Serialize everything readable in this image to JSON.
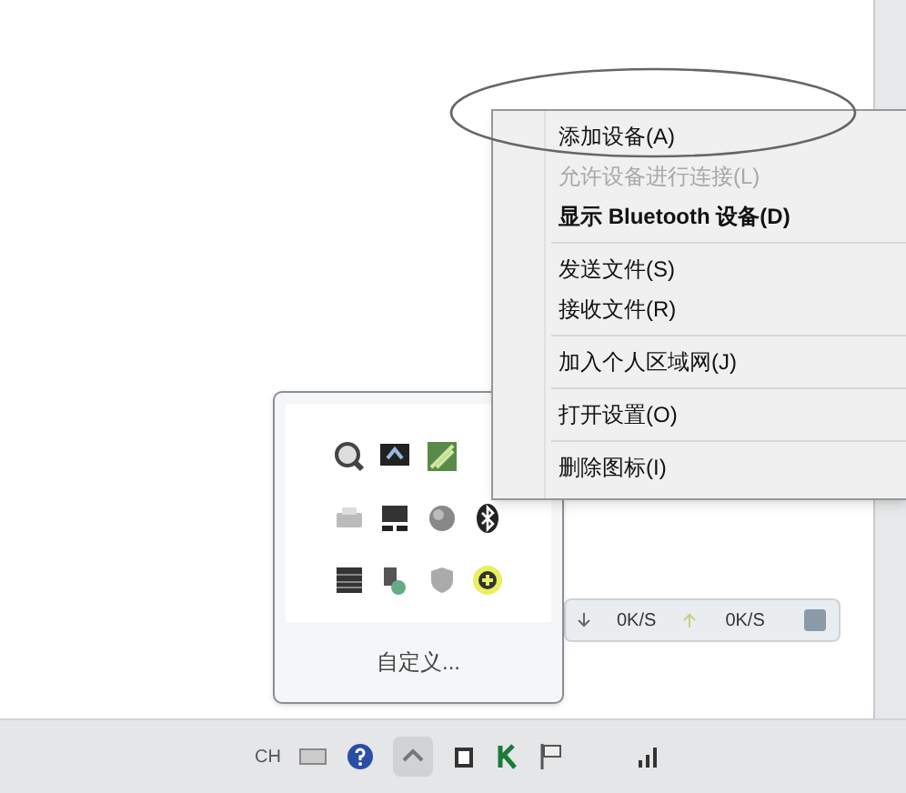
{
  "context_menu": {
    "groups": [
      [
        {
          "label": "添加设备(A)",
          "disabled": false,
          "default": false
        },
        {
          "label": "允许设备进行连接(L)",
          "disabled": true,
          "default": false
        },
        {
          "label": "显示 Bluetooth 设备(D)",
          "disabled": false,
          "default": true
        }
      ],
      [
        {
          "label": "发送文件(S)",
          "disabled": false,
          "default": false
        },
        {
          "label": "接收文件(R)",
          "disabled": false,
          "default": false
        }
      ],
      [
        {
          "label": "加入个人区域网(J)",
          "disabled": false,
          "default": false
        }
      ],
      [
        {
          "label": "打开设置(O)",
          "disabled": false,
          "default": false
        }
      ],
      [
        {
          "label": "删除图标(I)",
          "disabled": false,
          "default": false
        }
      ]
    ]
  },
  "tray_overflow": {
    "icon_rows": [
      [
        {
          "kind": "search"
        },
        {
          "kind": "monitor"
        },
        {
          "kind": "network"
        }
      ],
      [
        {
          "kind": "printer"
        },
        {
          "kind": "display"
        },
        {
          "kind": "globe"
        },
        {
          "kind": "bluetooth"
        }
      ],
      [
        {
          "kind": "keyboard"
        },
        {
          "kind": "usb"
        },
        {
          "kind": "shield"
        },
        {
          "kind": "plus"
        }
      ]
    ],
    "customize_link": "自定义..."
  },
  "net_speed": {
    "download": "0K/S",
    "upload": "0K/S"
  },
  "taskbar": {
    "language": "CH"
  }
}
